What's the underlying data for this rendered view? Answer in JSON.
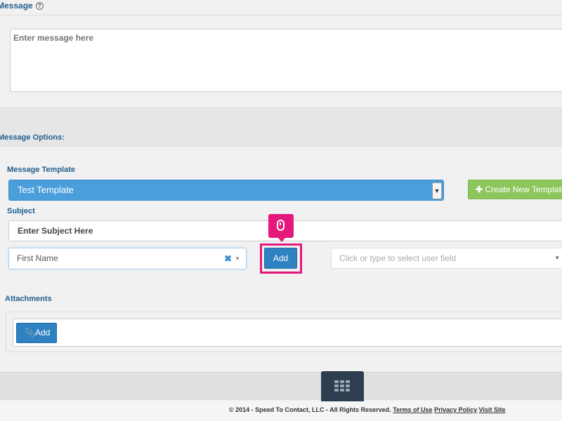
{
  "message": {
    "heading": "Message",
    "help_icon": "?",
    "placeholder": "Enter message here"
  },
  "options": {
    "heading": "Message Options:"
  },
  "template": {
    "label": "Message Template",
    "selected": "Test Template",
    "create_button": "Create New Template"
  },
  "subject": {
    "label": "Subject",
    "placeholder": "Enter Subject Here"
  },
  "field_insert": {
    "selected": "First Name",
    "add_button": "Add",
    "user_field_placeholder": "Click or type to select user field"
  },
  "attachments": {
    "label": "Attachments",
    "add_button": "Add"
  },
  "footer": {
    "copyright": "© 2014 - Speed To Contact, LLC - All Rights Reserved.",
    "terms_link": "Terms of Use",
    "privacy_link": "Privacy Policy",
    "visit_link": "Visit Site"
  },
  "colors": {
    "accent": "#e5187c",
    "primary": "#2f82c2",
    "success": "#8dc65d",
    "heading": "#1f5e8f"
  }
}
